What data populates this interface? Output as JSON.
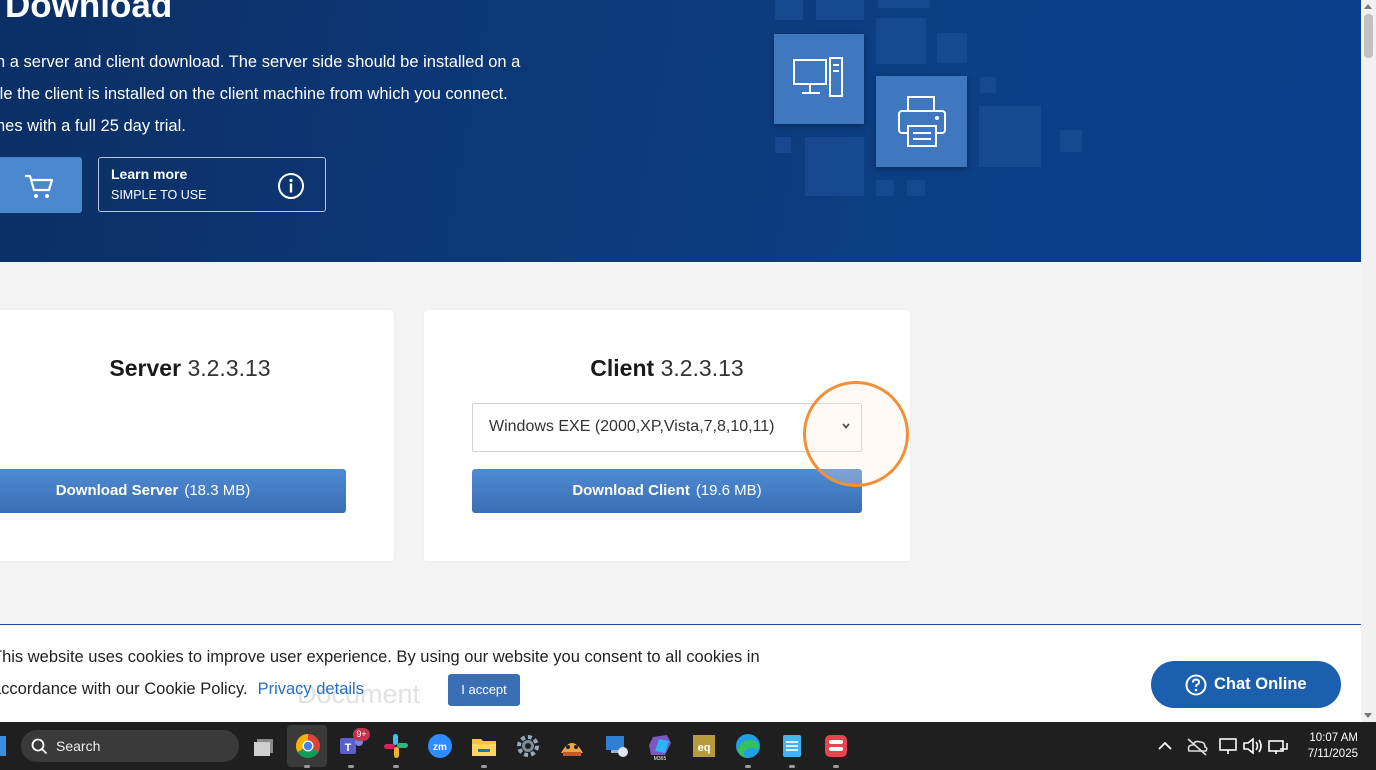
{
  "hero": {
    "title": "Download",
    "description_lines": [
      "n a server and client download. The server side should be installed on a",
      "ile the client is installed on the client machine from which you connect.",
      "nes with a full 25 day trial."
    ],
    "learn_more": {
      "title": "Learn more",
      "subtitle": "SIMPLE TO USE"
    }
  },
  "server_card": {
    "name": "Server",
    "version": "3.2.3.13",
    "download_label": "Download Server",
    "download_size": "(18.3 MB)"
  },
  "client_card": {
    "name": "Client",
    "version": "3.2.3.13",
    "platform_selected": "Windows EXE (2000,XP,Vista,7,8,10,11)",
    "download_label": "Download Client",
    "download_size": "(19.6 MB)"
  },
  "cookie_bar": {
    "text_line1": "This website uses cookies to improve user experience. By using our website you consent to all cookies in",
    "text_line2": "accordance with our Cookie Policy.",
    "privacy_link": "Privacy details",
    "accept_label": "I accept",
    "ghost_text": "Document"
  },
  "chat": {
    "label": "Chat Online"
  },
  "taskbar": {
    "search_placeholder": "Search",
    "teams_badge": "9+",
    "time": "10:07 AM",
    "date": "7/11/2025"
  },
  "colors": {
    "hero_bg": "#0d3a7a",
    "button_blue": "#3a6fb5",
    "highlight_circle": "#f0913a",
    "chat_bg": "#1b5fae"
  }
}
